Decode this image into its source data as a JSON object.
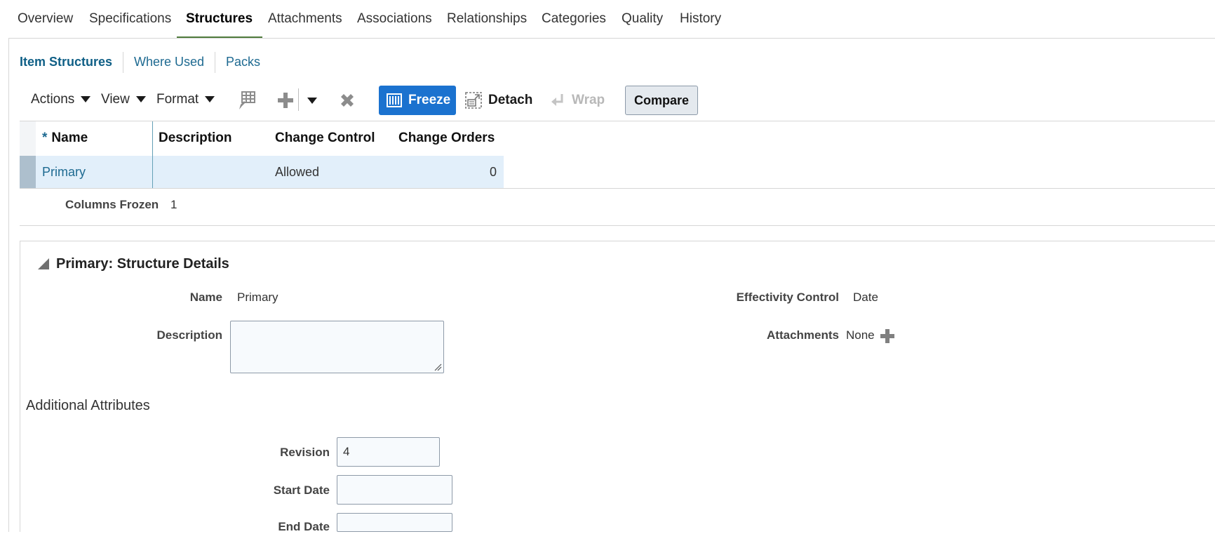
{
  "top_tabs": [
    "Overview",
    "Specifications",
    "Structures",
    "Attachments",
    "Associations",
    "Relationships",
    "Categories",
    "Quality",
    "History"
  ],
  "sub_tabs": [
    "Item Structures",
    "Where Used",
    "Packs"
  ],
  "toolbar": {
    "actions_label": "Actions",
    "view_label": "View",
    "format_label": "Format",
    "freeze_label": "Freeze",
    "detach_label": "Detach",
    "wrap_label": "Wrap",
    "compare_label": "Compare"
  },
  "table": {
    "required_marker": "*",
    "columns": [
      "Name",
      "Description",
      "Change Control",
      "Change Orders"
    ],
    "rows": [
      {
        "name": "Primary",
        "description": "",
        "change_control": "Allowed",
        "change_orders": "0"
      }
    ],
    "columns_frozen_label": "Columns Frozen",
    "columns_frozen_value": "1"
  },
  "details": {
    "title": "Primary: Structure Details",
    "name_label": "Name",
    "name_value": "Primary",
    "description_label": "Description",
    "description_value": "",
    "effectivity_label": "Effectivity Control",
    "effectivity_value": "Date",
    "attachments_label": "Attachments",
    "attachments_value": "None"
  },
  "additional": {
    "title": "Additional Attributes",
    "revision_label": "Revision",
    "revision_value": "4",
    "start_date_label": "Start Date",
    "start_date_value": "",
    "end_date_label": "End Date",
    "end_date_value": ""
  },
  "colors": {
    "active_tab_underline": "#4f7b3c",
    "link": "#1e6a91",
    "freeze_button": "#1b72cf",
    "selected_row": "#e2effa"
  }
}
